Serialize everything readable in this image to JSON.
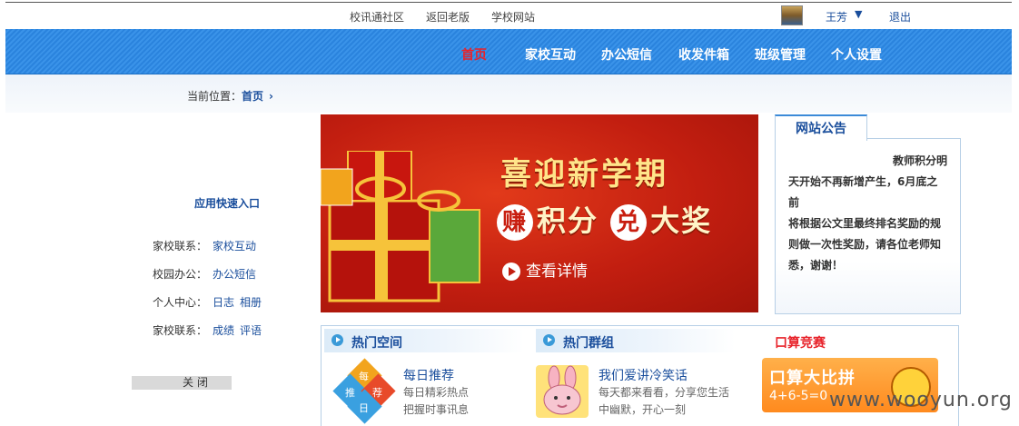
{
  "topbar": {
    "links": [
      "校讯通社区",
      "返回老版",
      "学校网站"
    ],
    "user_name": "王芳",
    "logout": "退出"
  },
  "nav": {
    "items": [
      "首页",
      "家校互动",
      "办公短信",
      "收发件箱",
      "班级管理",
      "个人设置"
    ],
    "active_index": 0
  },
  "breadcrumb": {
    "label": "当前位置：",
    "current": "首页"
  },
  "sidebar": {
    "title": "应用快速入口",
    "rows": [
      {
        "label": "家校联系：",
        "links": [
          "家校互动"
        ]
      },
      {
        "label": "校园办公：",
        "links": [
          "办公短信"
        ]
      },
      {
        "label": "个人中心：",
        "links": [
          "日志",
          "相册"
        ]
      },
      {
        "label": "家校联系：",
        "links": [
          "成绩",
          "评语"
        ]
      }
    ],
    "close": "关闭"
  },
  "banner": {
    "title": "喜迎新学期",
    "earn_char": "赚",
    "points": "积分",
    "redeem_char": "兑",
    "prize": "大奖",
    "more": "查看详情"
  },
  "announcement": {
    "tab": "网站公告",
    "lines": [
      "教师积分明",
      "天开始不再新增产生，6月底之前",
      "将根据公文里最终排名奖励的规",
      "则做一次性奖励，请各位老师知",
      "悉，谢谢！"
    ]
  },
  "hot": {
    "space_title": "热门空间",
    "group_title": "热门群组",
    "calc_title": "口算竞赛",
    "space_item": {
      "title": "每日推荐",
      "desc": [
        "每日精彩热点",
        "把握时事讯息"
      ],
      "thumb_chars": [
        "每",
        "推",
        "荐",
        "日"
      ]
    },
    "group_item": {
      "title": "我们爱讲冷笑话",
      "desc": [
        "每天都来看看，分享您生活",
        "中幽默，开心一刻"
      ]
    },
    "calc_banner": {
      "text": "口算大比拼",
      "equation": "4+6-5=0"
    }
  },
  "watermark": "www.wooyun.org",
  "colors": {
    "nav_blue": "#2a83dd",
    "link_blue": "#1a4e9c",
    "active_red": "#e8242b",
    "banner_red": "#c21e10"
  }
}
